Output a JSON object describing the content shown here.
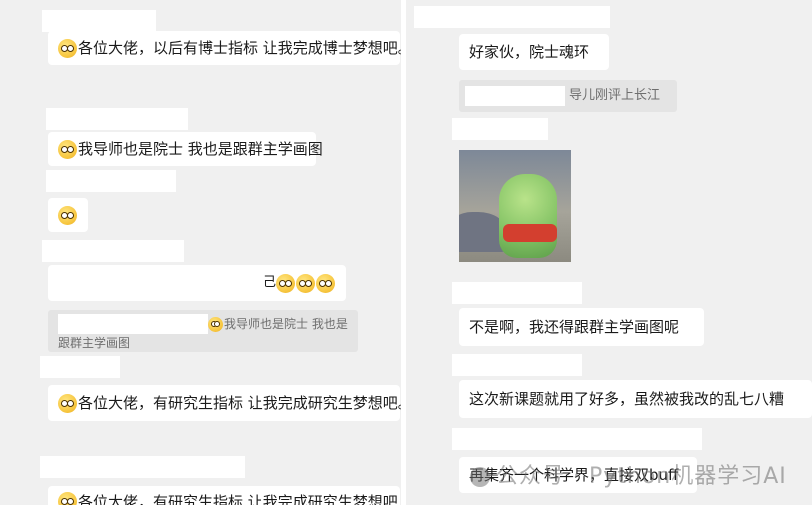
{
  "left_panel": {
    "messages": [
      {
        "text": "各位大佬，以后有博士指标 让我完成博士梦想吧。",
        "emoji": "smile-emoji"
      },
      {
        "text": "我导师也是院士 我也是跟群主学画图",
        "emoji": "laugh-cry-emoji"
      },
      {
        "text": "",
        "emoji": "surprised-emoji"
      },
      {
        "text": "",
        "emoji": "smile-emoji x3"
      },
      {
        "text": "各位大佬，有研究生指标 让我完成研究生梦想吧。",
        "emoji": "smile-emoji"
      },
      {
        "text": "各位大佬，有研究生指标 让我完成研究生梦想吧",
        "emoji": "smile-emoji"
      }
    ],
    "quote": {
      "line1": "我导师也是院士 我也是",
      "line2": "跟群主学画图"
    },
    "msg4_tail": "己"
  },
  "right_panel": {
    "messages": [
      {
        "text": "好家伙，院士魂环"
      },
      {
        "text": "不是啊，我还得跟群主学画图呢"
      },
      {
        "text": "这次新课题就用了好多，虽然被我改的乱七八糟"
      },
      {
        "text": "再集齐一个科学界，直接双buff"
      }
    ],
    "quote": {
      "text": "导儿刚评上长江"
    },
    "sticker": "frog-sticker"
  },
  "watermark": {
    "text": "公众号 · Python机器学习AI"
  }
}
